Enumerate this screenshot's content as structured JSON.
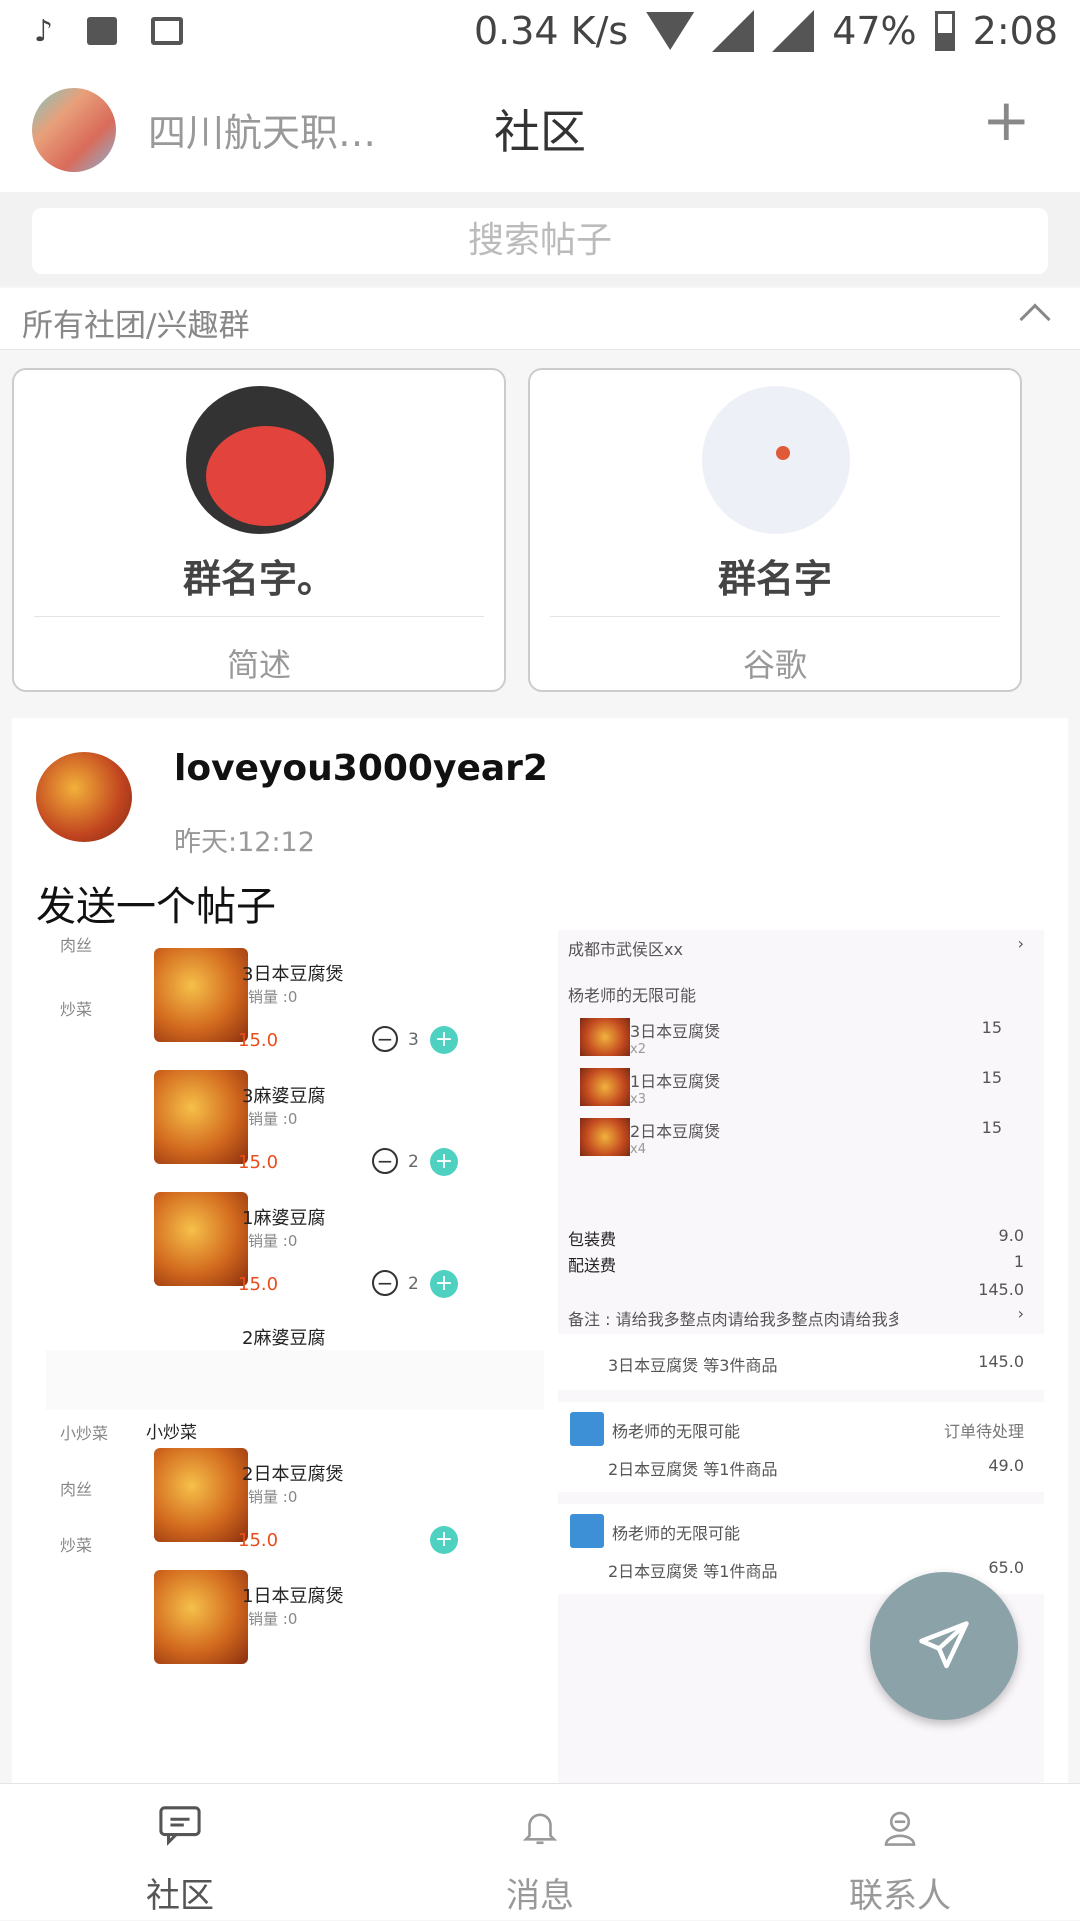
{
  "status_bar": {
    "net_speed": "0.34 K/s",
    "battery": "47%",
    "time": "2:08",
    "icons": [
      "tiktok-icon",
      "image-icon",
      "message-icon",
      "wifi-icon",
      "signal-icon",
      "battery-icon"
    ]
  },
  "header": {
    "school": "四川航天职业...",
    "title": "社区",
    "add": "+"
  },
  "search": {
    "placeholder": "搜索帖子"
  },
  "section": {
    "label": "所有社团/兴趣群"
  },
  "groups": [
    {
      "name": "群名字。",
      "desc": "简述"
    },
    {
      "name": "群名字",
      "desc": "谷歌"
    }
  ],
  "post": {
    "user": "loveyou3000year2",
    "time": "昨天:12:12",
    "text": "发送一个帖子"
  },
  "screenshot_left": {
    "categories": [
      "肉丝",
      "炒菜",
      "小炒菜",
      "肉丝",
      "炒菜"
    ],
    "section_title": "小炒菜",
    "items": [
      {
        "name": "3日本豆腐煲",
        "sales": "销量 :0",
        "price": "15.0",
        "qty": "3"
      },
      {
        "name": "3麻婆豆腐",
        "sales": "销量 :0",
        "price": "15.0",
        "qty": "2"
      },
      {
        "name": "1麻婆豆腐",
        "sales": "销量 :0",
        "price": "15.0",
        "qty": "2"
      },
      {
        "name": "2麻婆豆腐"
      },
      {
        "name": "2日本豆腐煲",
        "sales": "销量 :0",
        "price": "15.0"
      },
      {
        "name": "1日本豆腐煲",
        "sales": "销量 :0"
      }
    ]
  },
  "screenshot_right": {
    "address": "成都市武侯区xx",
    "shop": "杨老师的无限可能",
    "order_items": [
      {
        "name": "3日本豆腐煲",
        "count": "x2",
        "price": "15"
      },
      {
        "name": "1日本豆腐煲",
        "count": "x3",
        "price": "15"
      },
      {
        "name": "2日本豆腐煲",
        "count": "x4",
        "price": "15"
      }
    ],
    "fees": [
      {
        "label": "包装费",
        "value": "9.0"
      },
      {
        "label": "配送费",
        "value": "1"
      }
    ],
    "total": "145.0",
    "note": "备注 : 请给我多整点肉请给我多整点肉请给我多整点肉",
    "orders": [
      {
        "summary": "3日本豆腐煲 等3件商品",
        "amount": "145.0"
      },
      {
        "shop": "杨老师的无限可能",
        "status": "订单待处理",
        "summary": "2日本豆腐煲 等1件商品",
        "amount": "49.0"
      },
      {
        "shop": "杨老师的无限可能",
        "summary": "2日本豆腐煲 等1件商品",
        "amount": "65.0"
      }
    ]
  },
  "tabs": [
    {
      "label": "社区",
      "color": "#555555"
    },
    {
      "label": "消息",
      "color": "#999999"
    },
    {
      "label": "联系人",
      "color": "#999999"
    }
  ]
}
